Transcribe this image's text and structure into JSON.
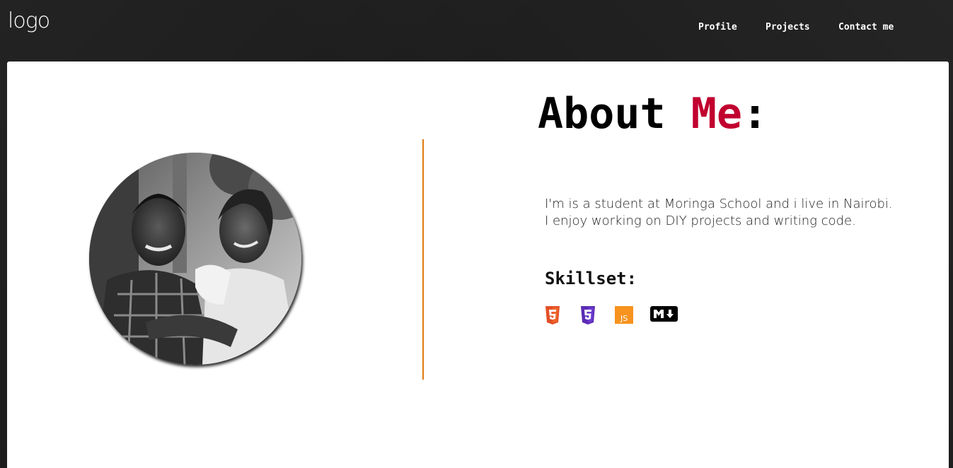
{
  "header": {
    "logo": "logo",
    "nav": [
      {
        "label": "Profile"
      },
      {
        "label": "Projects"
      },
      {
        "label": "Contact me"
      }
    ]
  },
  "about": {
    "title_main": "About ",
    "title_accent": "Me",
    "title_colon": ":",
    "bio_line1": "I'm is a student at Moringa School and i live in Nairobi.",
    "bio_line2": "I enjoy working on DIY projects and writing code.",
    "skillset_heading": "Skillset:",
    "skills": [
      {
        "icon": "html5-icon",
        "color": "#e34f26"
      },
      {
        "icon": "css3-icon",
        "color": "#5b2bb5"
      },
      {
        "icon": "javascript-icon",
        "color": "#f7931e",
        "text": "JS"
      },
      {
        "icon": "markdown-icon",
        "color": "#000000"
      }
    ]
  },
  "colors": {
    "accent": "#c1002f",
    "divider": "#e07a10",
    "header_bg": "#1c1c1c"
  }
}
